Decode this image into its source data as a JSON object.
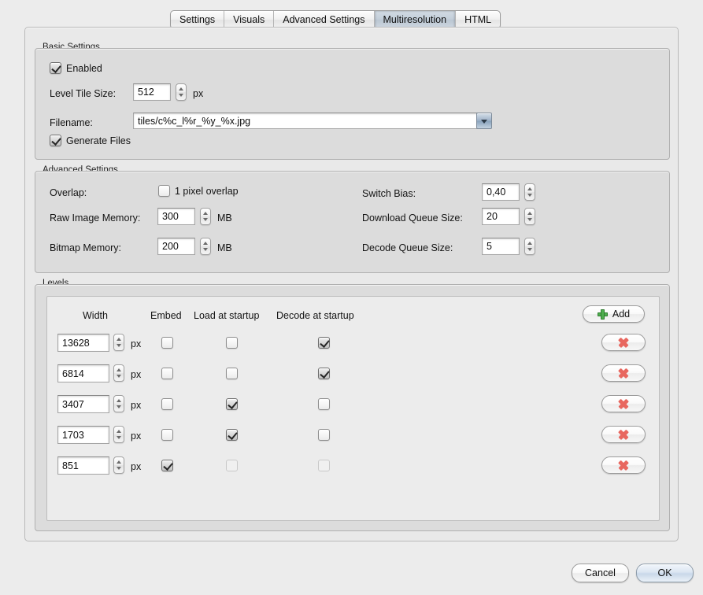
{
  "tabs": [
    {
      "label": "Settings",
      "selected": false
    },
    {
      "label": "Visuals",
      "selected": false
    },
    {
      "label": "Advanced Settings",
      "selected": false
    },
    {
      "label": "Multiresolution",
      "selected": true
    },
    {
      "label": "HTML",
      "selected": false
    }
  ],
  "basic": {
    "title": "Basic Settings",
    "enabled_label": "Enabled",
    "enabled_checked": true,
    "tile_size_label": "Level Tile Size:",
    "tile_size_value": "512",
    "tile_size_unit": "px",
    "filename_label": "Filename:",
    "filename_value": "tiles/c%c_l%r_%y_%x.jpg",
    "generate_files_label": "Generate Files",
    "generate_files_checked": true
  },
  "advanced": {
    "title": "Advanced Settings",
    "overlap_label": "Overlap:",
    "overlap_checkbox_label": "1 pixel overlap",
    "overlap_checked": false,
    "raw_image_memory_label": "Raw Image Memory:",
    "raw_image_memory_value": "300",
    "raw_image_memory_unit": "MB",
    "bitmap_memory_label": "Bitmap Memory:",
    "bitmap_memory_value": "200",
    "bitmap_memory_unit": "MB",
    "switch_bias_label": "Switch Bias:",
    "switch_bias_value": "0,40",
    "download_queue_label": "Download Queue Size:",
    "download_queue_value": "20",
    "decode_queue_label": "Decode Queue Size:",
    "decode_queue_value": "5"
  },
  "levels": {
    "title": "Levels",
    "columns": {
      "width": "Width",
      "embed": "Embed",
      "load": "Load at startup",
      "decode": "Decode at startup"
    },
    "unit": "px",
    "add_button_label": "Add",
    "rows": [
      {
        "width": "13628",
        "embed": false,
        "load": false,
        "decode": true,
        "load_disabled": false,
        "decode_disabled": false
      },
      {
        "width": "6814",
        "embed": false,
        "load": false,
        "decode": true,
        "load_disabled": false,
        "decode_disabled": false
      },
      {
        "width": "3407",
        "embed": false,
        "load": true,
        "decode": false,
        "load_disabled": false,
        "decode_disabled": false
      },
      {
        "width": "1703",
        "embed": false,
        "load": true,
        "decode": false,
        "load_disabled": false,
        "decode_disabled": false
      },
      {
        "width": "851",
        "embed": true,
        "load": false,
        "decode": false,
        "load_disabled": true,
        "decode_disabled": true
      }
    ]
  },
  "footer": {
    "cancel_label": "Cancel",
    "ok_label": "OK"
  },
  "colors": {
    "accent_green": "#4fae4f",
    "accent_red": "#e8675f",
    "selected_tab": "#c3ced9",
    "panel": "#dcdcdc",
    "background": "#ececec"
  }
}
